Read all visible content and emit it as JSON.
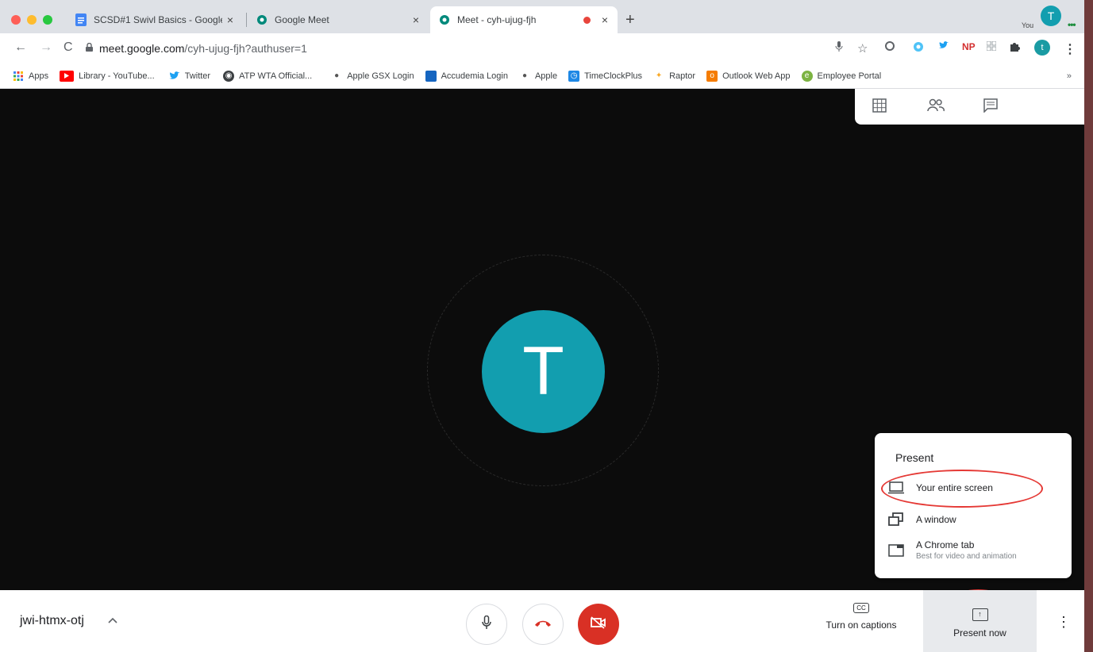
{
  "browser": {
    "tabs": [
      {
        "title": "SCSD#1 Swivl Basics - Google",
        "icon": "docs-icon"
      },
      {
        "title": "Google Meet",
        "icon": "meet-icon"
      },
      {
        "title": "Meet - cyh-ujug-fjh",
        "icon": "meet-icon",
        "active": true,
        "recording": true
      }
    ],
    "close_glyph": "×",
    "new_tab_glyph": "+",
    "url_host": "meet.google.com",
    "url_path": "/cyh-ujug-fjh?authuser=1",
    "profile_initial": "t",
    "extension_np": "NP",
    "bookmarks": [
      {
        "label": "Apps",
        "icon": "apps-grid-icon"
      },
      {
        "label": "Library - YouTube...",
        "icon": "youtube-icon"
      },
      {
        "label": "Twitter",
        "icon": "twitter-icon"
      },
      {
        "label": "ATP WTA Official...",
        "icon": "globe-icon"
      },
      {
        "label": "Apple GSX Login",
        "icon": "apple-icon"
      },
      {
        "label": "Accudemia Login",
        "icon": "accudemia-icon"
      },
      {
        "label": "Apple",
        "icon": "apple-icon"
      },
      {
        "label": "TimeClockPlus",
        "icon": "timeclock-icon"
      },
      {
        "label": "Raptor",
        "icon": "raptor-icon"
      },
      {
        "label": "Outlook Web App",
        "icon": "outlook-icon"
      },
      {
        "label": "Employee Portal",
        "icon": "portal-icon"
      }
    ],
    "bookmarks_overflow": "»"
  },
  "meet": {
    "participant_initial": "T",
    "self_label": "You",
    "self_initial": "T",
    "present_menu": {
      "title": "Present",
      "options": [
        {
          "label": "Your entire screen",
          "sub": "",
          "icon": "monitor-icon"
        },
        {
          "label": "A window",
          "sub": "",
          "icon": "window-icon"
        },
        {
          "label": "A Chrome tab",
          "sub": "Best for video and animation",
          "icon": "chrome-tab-icon"
        }
      ]
    },
    "meeting_code": "jwi-htmx-otj",
    "captions_label": "Turn on captions",
    "captions_icon_text": "CC",
    "present_now_label": "Present now"
  },
  "colors": {
    "accent_teal": "#129eaf",
    "hangup_red": "#d93025",
    "annotation_red": "#e53935"
  }
}
